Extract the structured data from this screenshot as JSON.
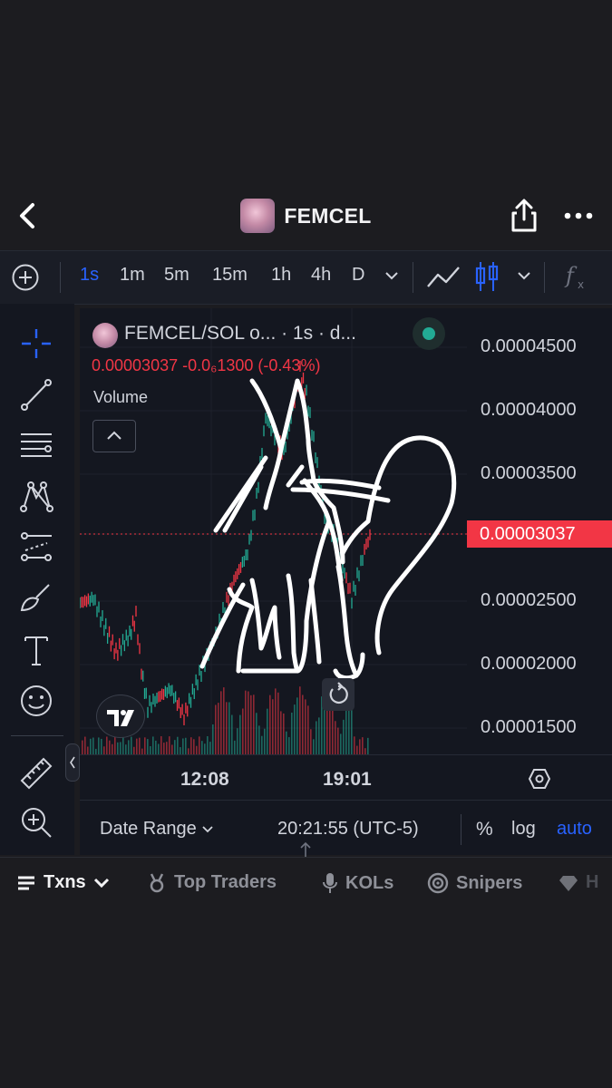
{
  "header": {
    "title": "FEMCEL"
  },
  "toolbar": {
    "timeframes": [
      "1s",
      "1m",
      "5m",
      "15m",
      "1h",
      "4h",
      "D"
    ],
    "active_timeframe": "1s"
  },
  "chart": {
    "legend_title": "FEMCEL/SOL o... · 1s · d...",
    "price_line": "0.00003037  -0.0₆1300 (-0.43%)",
    "volume_label": "Volume",
    "current_price": "0.00003037",
    "y_ticks": [
      "0.00004500",
      "0.00004000",
      "0.00003500",
      "0.00002500",
      "0.00002000",
      "0.00001500"
    ],
    "x_ticks": [
      "12:08",
      "19:01"
    ],
    "colors": {
      "up": "#22ab94",
      "down": "#f23645",
      "accent": "#2962ff"
    }
  },
  "footer": {
    "date_range": "Date Range",
    "clock": "20:21:55 (UTC-5)",
    "percent": "%",
    "log": "log",
    "auto": "auto"
  },
  "tabs": [
    {
      "label": "Txns",
      "icon": "list-icon",
      "active": true
    },
    {
      "label": "Top Traders",
      "icon": "medal-icon"
    },
    {
      "label": "KOLs",
      "icon": "microphone-icon"
    },
    {
      "label": "Snipers",
      "icon": "target-icon"
    },
    {
      "label": "H",
      "icon": "diamond-icon"
    }
  ]
}
